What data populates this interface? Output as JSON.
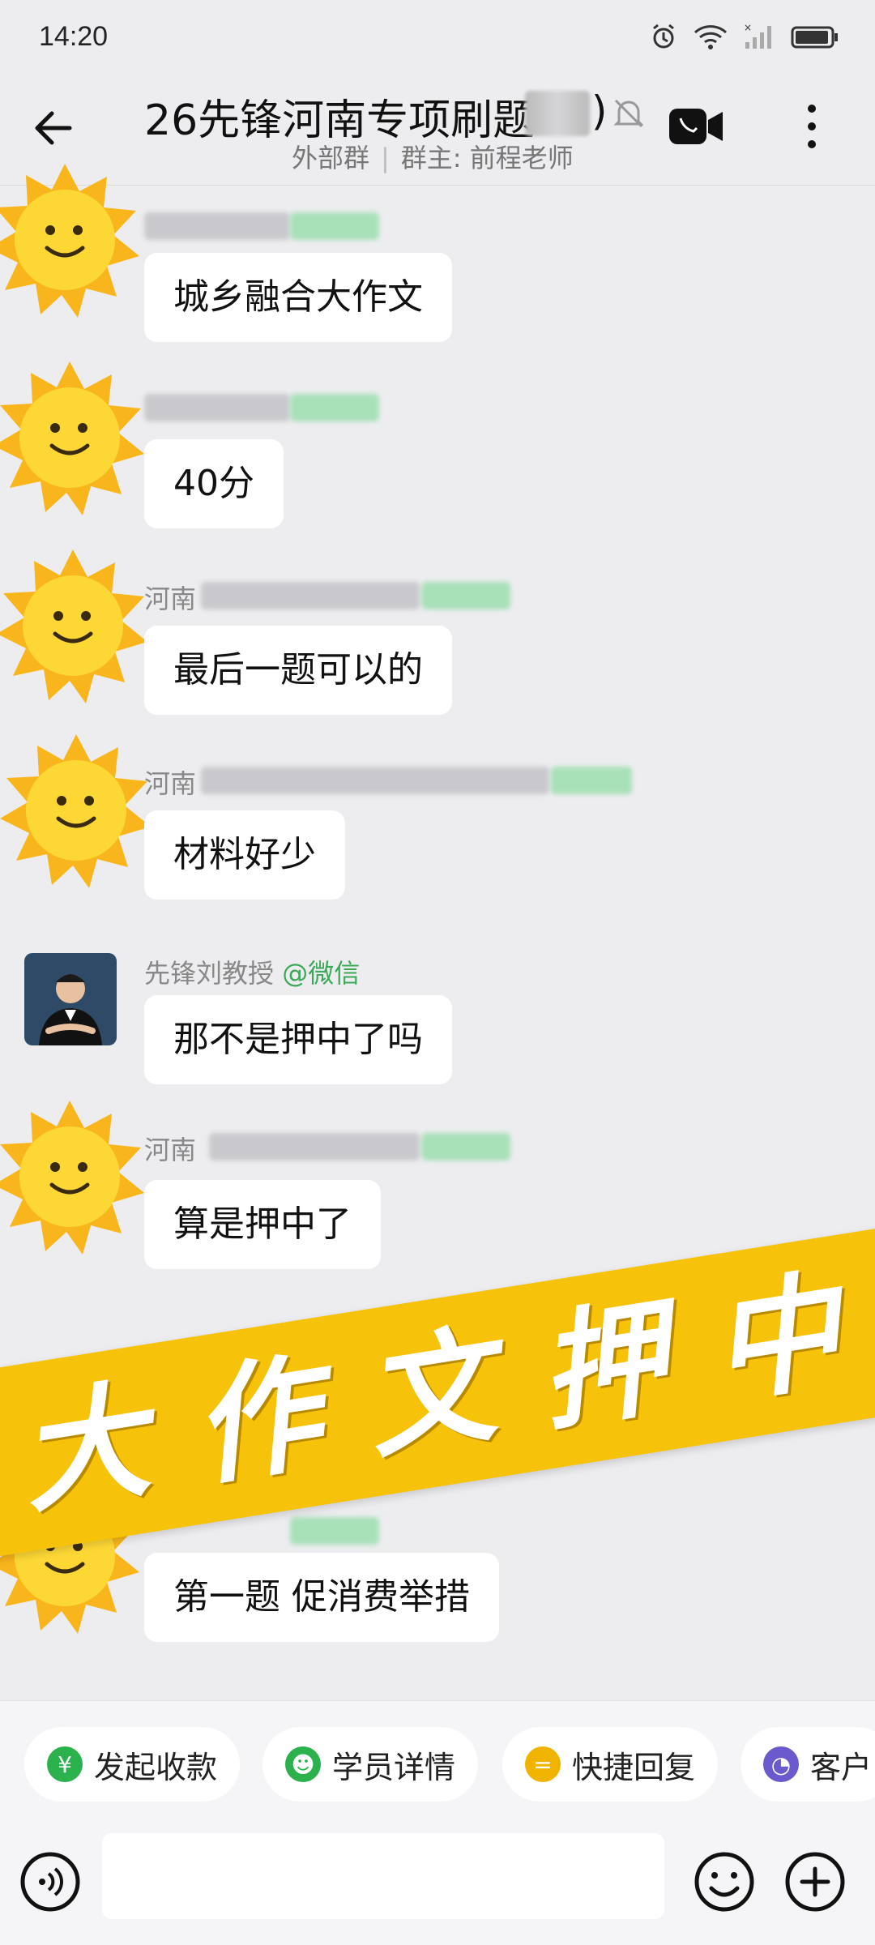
{
  "status": {
    "time": "14:20"
  },
  "header": {
    "title": "26先锋河南专项刷题",
    "title_suffix": ")",
    "group_type": "外部群",
    "owner_label": "群主: 前程老师"
  },
  "messages": [
    {
      "sender": "",
      "text": "城乡融合大作文"
    },
    {
      "sender": "",
      "text": "40分"
    },
    {
      "sender": "河南",
      "text": "最后一题可以的"
    },
    {
      "sender": "河南",
      "text": "材料好少"
    },
    {
      "sender": "先锋刘教授",
      "sender_tag": "@微信",
      "text": "那不是押中了吗"
    },
    {
      "sender": "河南",
      "text": "算是押中了"
    },
    {
      "sender": "",
      "text": "第一题 促消费举措"
    }
  ],
  "banner": {
    "text": "大作文押中"
  },
  "toolbar": {
    "items": [
      {
        "label": "发起收款",
        "icon": "payment-icon",
        "color": "#2bb24c"
      },
      {
        "label": "学员详情",
        "icon": "student-icon",
        "color": "#2bb24c"
      },
      {
        "label": "快捷回复",
        "icon": "quick-reply-icon",
        "color": "#f0b400"
      },
      {
        "label": "客户",
        "icon": "customer-icon",
        "color": "#6a5acd"
      }
    ]
  },
  "input": {
    "placeholder": ""
  },
  "colors": {
    "background": "#ededf0",
    "banner": "#f6c20a",
    "tag_green": "#3aa857"
  }
}
